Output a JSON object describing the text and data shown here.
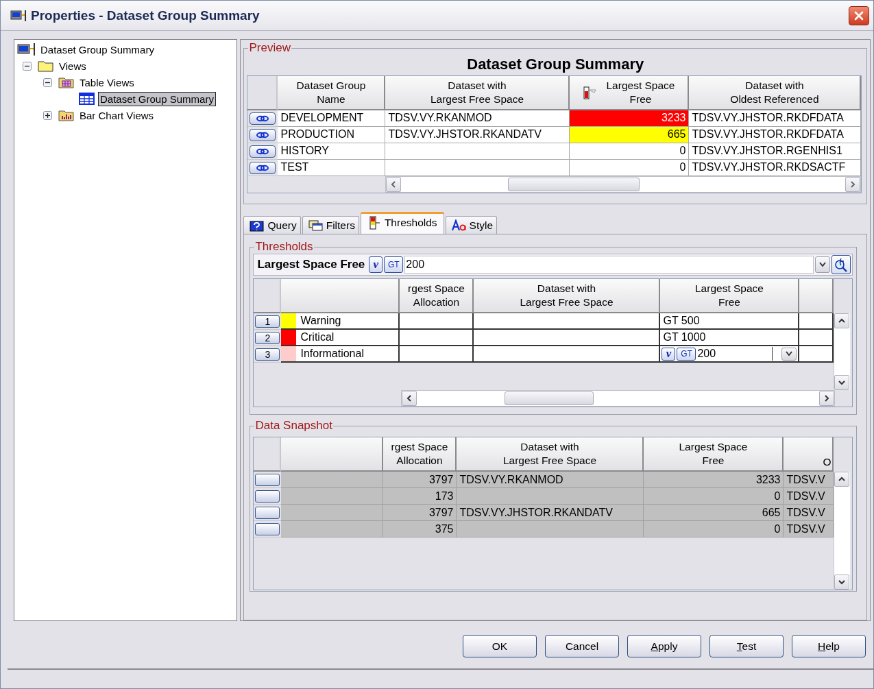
{
  "window": {
    "title": "Properties - Dataset Group Summary"
  },
  "tree": [
    {
      "label": "Dataset Group Summary",
      "kind": "app",
      "selected": false,
      "children": [
        {
          "label": "Views",
          "kind": "folder",
          "expanded": true,
          "selected": false,
          "children": [
            {
              "label": "Table Views",
              "kind": "table-folder",
              "expanded": true,
              "selected": false,
              "children": [
                {
                  "label": "Dataset Group Summary",
                  "kind": "table",
                  "selected": true
                }
              ]
            },
            {
              "label": "Bar Chart Views",
              "kind": "chart-folder",
              "expanded": false,
              "selected": false
            }
          ]
        }
      ]
    }
  ],
  "preview": {
    "legend": "Preview",
    "title": "Dataset Group Summary",
    "columns": [
      {
        "label": "Dataset Group\nName",
        "threshold_icon": false
      },
      {
        "label": "Dataset with\nLargest Free Space",
        "threshold_icon": false
      },
      {
        "label": "Largest Space\nFree",
        "threshold_icon": true
      },
      {
        "label": "Dataset with\nOldest Referenced",
        "threshold_icon": false
      }
    ],
    "rows": [
      {
        "name": "DEVELOPMENT",
        "largest_dataset": "TDSV.VY.RKANMOD",
        "free": "3233",
        "color": "#ff0000",
        "oldest": "TDSV.VY.JHSTOR.RKDFDATA"
      },
      {
        "name": "PRODUCTION",
        "largest_dataset": "TDSV.VY.JHSTOR.RKANDATV",
        "free": "665",
        "color": "#ffff00",
        "oldest": "TDSV.VY.JHSTOR.RKDFDATA"
      },
      {
        "name": "HISTORY",
        "free": "0",
        "oldest": "TDSV.VY.JHSTOR.RGENHIS1"
      },
      {
        "name": "TEST",
        "free": "0",
        "oldest": "TDSV.VY.JHSTOR.RKDSACTF"
      }
    ]
  },
  "tabs": [
    {
      "label": "Query",
      "kind": "query",
      "selected": false
    },
    {
      "label": "Filters",
      "kind": "filters",
      "selected": false
    },
    {
      "label": "Thresholds",
      "kind": "thresholds",
      "selected": true
    },
    {
      "label": "Style",
      "kind": "style",
      "selected": false
    }
  ],
  "thresholds": {
    "legend": "Thresholds",
    "column_name": "Largest Space Free",
    "variable_symbol": "v",
    "operator": "GT",
    "value": "200",
    "columns": [
      "rgest Space\nAllocation",
      "Dataset with\nLargest Free Space",
      "Largest Space\nFree"
    ],
    "rows": [
      {
        "kind": "text",
        "number": "1",
        "color": "#ffff00",
        "name": "Warning",
        "free": "GT 500"
      },
      {
        "kind": "text",
        "number": "2",
        "color": "#ff0000",
        "name": "Critical",
        "free": "GT 1000"
      },
      {
        "kind": "editing",
        "number": "3",
        "color": "#ffcccc",
        "name": "Informational",
        "editor": {
          "variable_symbol": "v",
          "operator": "GT",
          "value": "200"
        }
      }
    ]
  },
  "snapshot": {
    "legend": "Data Snapshot",
    "columns": [
      "rgest Space\nAllocation",
      "Dataset with\nLargest Free Space",
      "Largest Space\nFree",
      "O"
    ],
    "rows": [
      {
        "allocation": "3797",
        "largest_dataset": "TDSV.VY.RKANMOD",
        "free": "3233",
        "oldest": "TDSV.V"
      },
      {
        "allocation": "173",
        "free": "0",
        "oldest": "TDSV.V"
      },
      {
        "allocation": "3797",
        "largest_dataset": "TDSV.VY.JHSTOR.RKANDATV",
        "free": "665",
        "oldest": "TDSV.V"
      },
      {
        "allocation": "375",
        "free": "0",
        "oldest": "TDSV.V"
      }
    ]
  },
  "buttons": [
    {
      "label": "OK",
      "mnemonic_first": false
    },
    {
      "label": "Cancel",
      "mnemonic_first": false
    },
    {
      "label": "Apply",
      "mnemonic_first": true
    },
    {
      "label": "Test",
      "mnemonic_first": true
    },
    {
      "label": "Help",
      "mnemonic_first": true
    }
  ]
}
